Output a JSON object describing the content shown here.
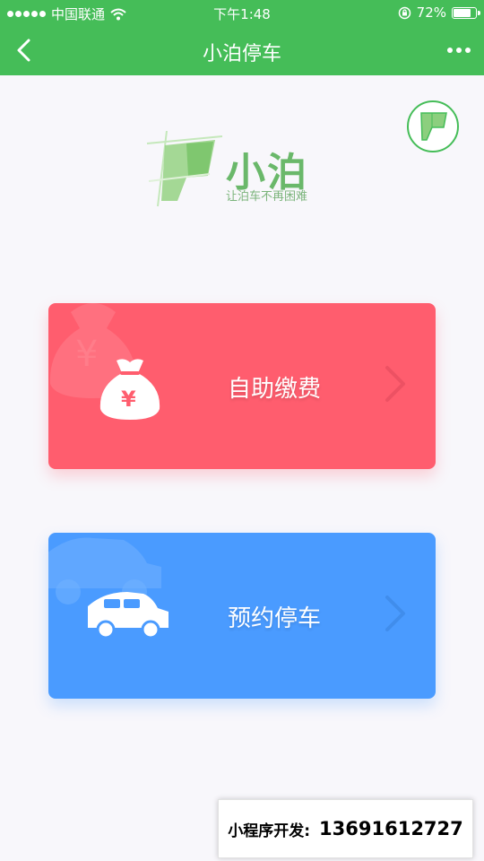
{
  "status": {
    "carrier": "中国联通",
    "time": "下午1:48",
    "battery": "72%",
    "battery_level": 0.72
  },
  "nav": {
    "title": "小泊停车",
    "back_icon": "chevron-left-icon",
    "more_icon": "more-dots-icon"
  },
  "brand": {
    "name": "小泊",
    "slogan": "让泊车不再困难"
  },
  "cards": [
    {
      "label": "自助缴费",
      "icon": "money-bag-icon",
      "color": "#ff5d6e"
    },
    {
      "label": "预约停车",
      "icon": "car-icon",
      "color": "#4a9bff"
    }
  ],
  "developer": {
    "label": "小程序开发:",
    "phone": "13691612727"
  },
  "colors": {
    "theme_green": "#45bd58"
  }
}
